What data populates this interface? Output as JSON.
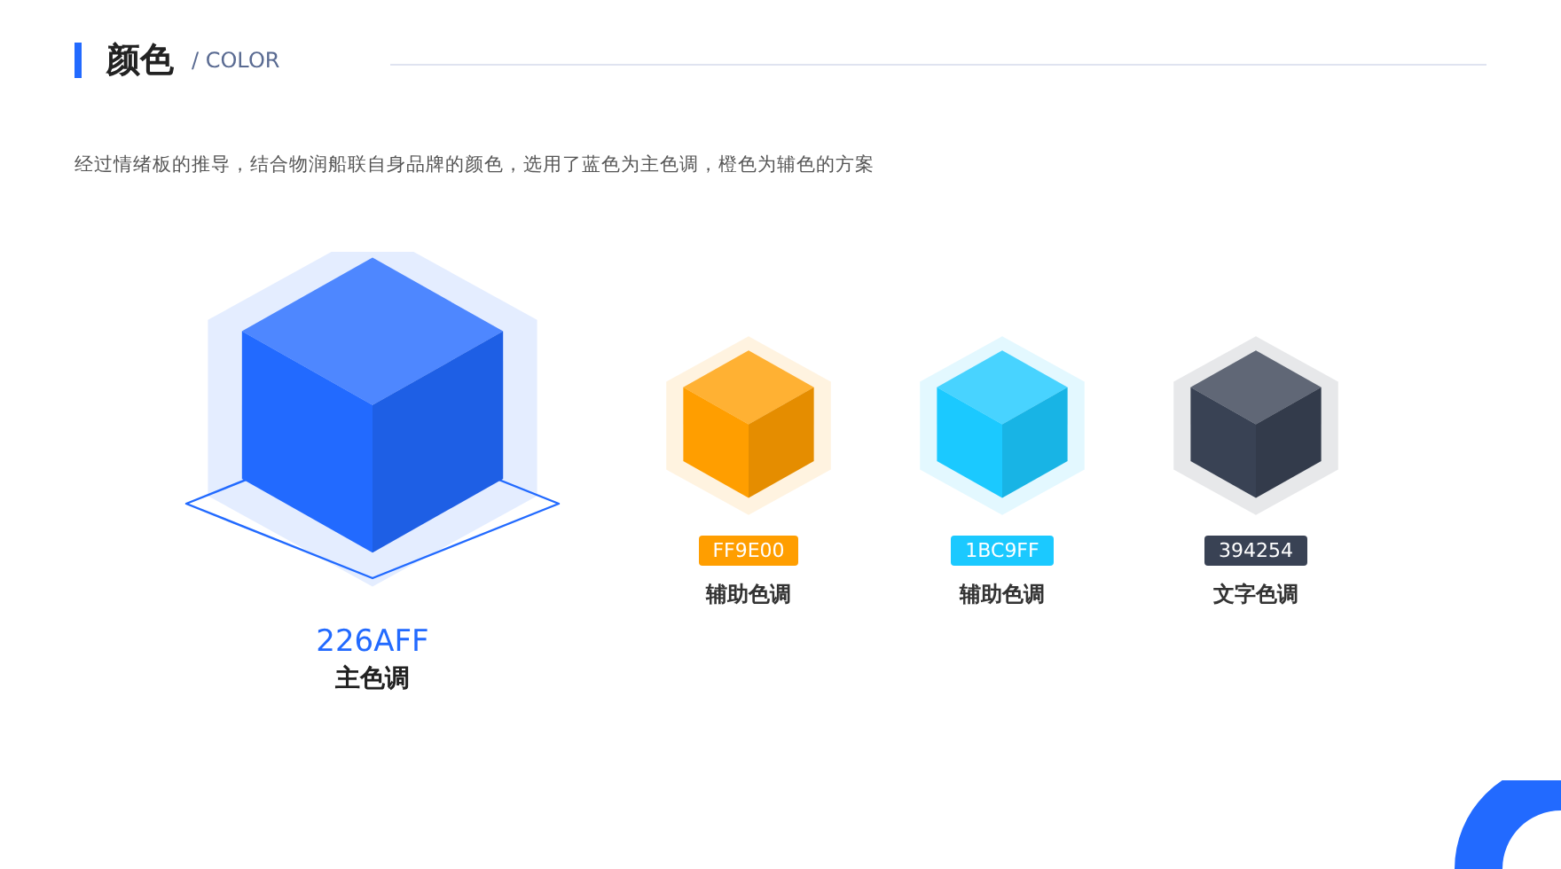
{
  "header": {
    "title": "颜色",
    "subtitle": "/ COLOR"
  },
  "description": "经过情绪板的推导，结合物润船联自身品牌的颜色，选用了蓝色为主色调，橙色为辅色的方案",
  "primary": {
    "code": "226AFF",
    "label": "主色调",
    "color": "#226aff"
  },
  "swatches": [
    {
      "code": "FF9E00",
      "label": "辅助色调",
      "color": "#ff9e00"
    },
    {
      "code": "1BC9FF",
      "label": "辅助色调",
      "color": "#1bc9ff"
    },
    {
      "code": "394254",
      "label": "文字色调",
      "color": "#394254"
    }
  ]
}
